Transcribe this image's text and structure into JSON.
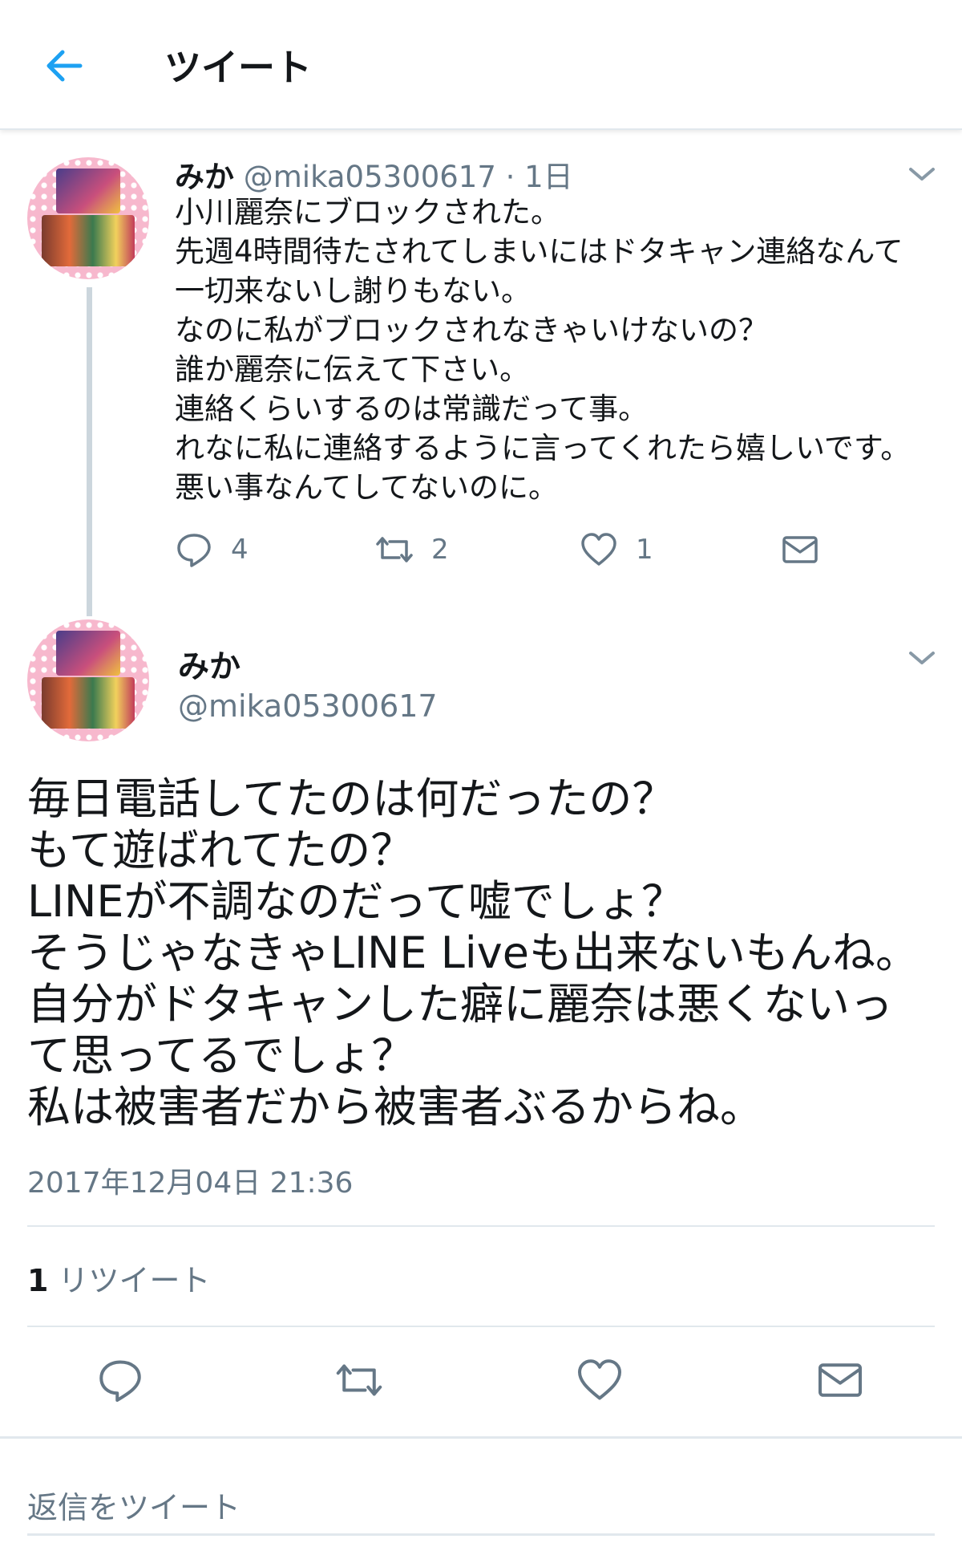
{
  "header": {
    "title": "ツイート",
    "back_icon": "arrow-left-icon",
    "accent": "#1da1f2"
  },
  "parent_tweet": {
    "name": "みか",
    "handle": "@mika05300617",
    "separator": "·",
    "time": "1日",
    "lines": [
      "小川麗奈にブロックされた。",
      "先週4時間待たされてしまいにはドタキャン連絡なんて",
      "一切来ないし謝りもない。",
      "なのに私がブロックされなきゃいけないの？",
      "誰か麗奈に伝えて下さい。",
      "連絡くらいするのは常識だって事。",
      "れなに私に連絡するように言ってくれたら嬉しいです。",
      "悪い事なんてしてないのに。"
    ],
    "reply_count": "4",
    "retweet_count": "2",
    "like_count": "1"
  },
  "main_tweet": {
    "name": "みか",
    "handle": "@mika05300617",
    "lines": [
      "毎日電話してたのは何だったの？",
      "もて遊ばれてたの？",
      "LINEが不調なのだって嘘でしょ？",
      "そうじゃなきゃLINE Liveも出来ないもんね。",
      "自分がドタキャンした癖に麗奈は悪くないっ",
      "て思ってるでしょ？",
      "私は被害者だから被害者ぶるからね。"
    ],
    "timestamp": "2017年12月04日 21:36",
    "retweet_count": "1",
    "retweet_label": "リツイート"
  },
  "reply": {
    "placeholder": "返信をツイート"
  },
  "colors": {
    "text": "#14171a",
    "secondary": "#657786",
    "border": "#e1e8ed"
  }
}
